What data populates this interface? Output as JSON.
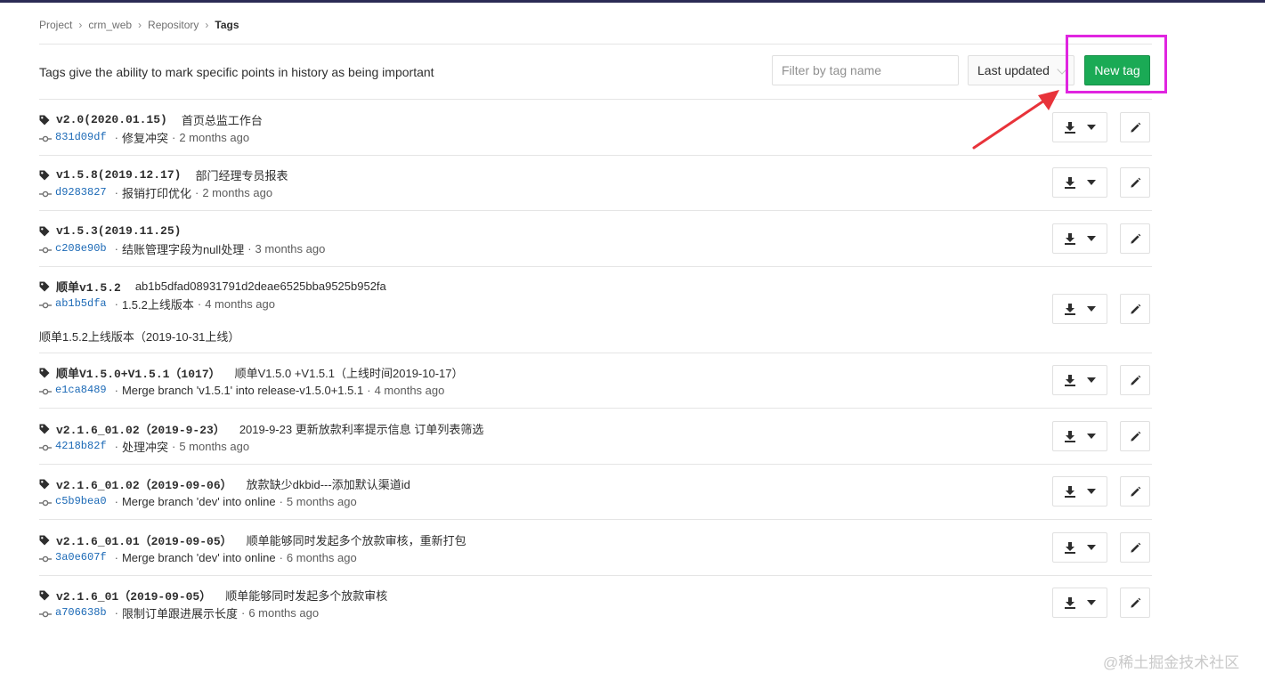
{
  "breadcrumb": [
    "Project",
    "crm_web",
    "Repository",
    "Tags"
  ],
  "intro": "Tags give the ability to mark specific points in history as being important",
  "filter": {
    "placeholder": "Filter by tag name"
  },
  "sort": {
    "selected": "Last updated"
  },
  "new_tag_label": "New tag",
  "tags": [
    {
      "name": "v2.0(2020.01.15)",
      "message": "首页总监工作台",
      "sha": "831d09df",
      "commit_msg": "修复冲突",
      "ago": "2 months ago",
      "release_note": ""
    },
    {
      "name": "v1.5.8(2019.12.17)",
      "message": "部门经理专员报表",
      "sha": "d9283827",
      "commit_msg": "报销打印优化",
      "ago": "2 months ago",
      "release_note": ""
    },
    {
      "name": "v1.5.3(2019.11.25)",
      "message": "",
      "sha": "c208e90b",
      "commit_msg": "结账管理字段为null处理",
      "ago": "3 months ago",
      "release_note": ""
    },
    {
      "name": "顺单v1.5.2",
      "message": "ab1b5dfad08931791d2deae6525bba9525b952fa",
      "sha": "ab1b5dfa",
      "commit_msg": "1.5.2上线版本",
      "ago": "4 months ago",
      "release_note": "顺单1.5.2上线版本（2019-10-31上线）"
    },
    {
      "name": "顺单V1.5.0+V1.5.1（1017）",
      "message": "顺单V1.5.0 +V1.5.1（上线时间2019-10-17）",
      "sha": "e1ca8489",
      "commit_msg": "Merge branch 'v1.5.1' into release-v1.5.0+1.5.1",
      "ago": "4 months ago",
      "release_note": ""
    },
    {
      "name": "v2.1.6_01.02（2019-9-23）",
      "message": "2019-9-23 更新放款利率提示信息 订单列表筛选",
      "sha": "4218b82f",
      "commit_msg": "处理冲突",
      "ago": "5 months ago",
      "release_note": ""
    },
    {
      "name": "v2.1.6_01.02（2019-09-06）",
      "message": "放款缺少dkbid---添加默认渠道id",
      "sha": "c5b9bea0",
      "commit_msg": "Merge branch 'dev' into online",
      "ago": "5 months ago",
      "release_note": ""
    },
    {
      "name": "v2.1.6_01.01（2019-09-05）",
      "message": "顺单能够同时发起多个放款审核，重新打包",
      "sha": "3a0e607f",
      "commit_msg": "Merge branch 'dev' into online",
      "ago": "6 months ago",
      "release_note": ""
    },
    {
      "name": "v2.1.6_01（2019-09-05）",
      "message": "顺单能够同时发起多个放款审核",
      "sha": "a706638b",
      "commit_msg": "限制订单跟进展示长度",
      "ago": "6 months ago",
      "release_note": ""
    }
  ],
  "watermark": "@稀土掘金技术社区",
  "colors": {
    "accent_green": "#1aaa55",
    "highlight_magenta": "#e025e0",
    "arrow_red": "#e8333a",
    "link_blue": "#1b69b6"
  },
  "icons": {
    "tag": "tag-icon",
    "commit": "commit-icon",
    "download": "download-icon",
    "caret": "caret-down-icon",
    "edit": "pencil-icon"
  }
}
